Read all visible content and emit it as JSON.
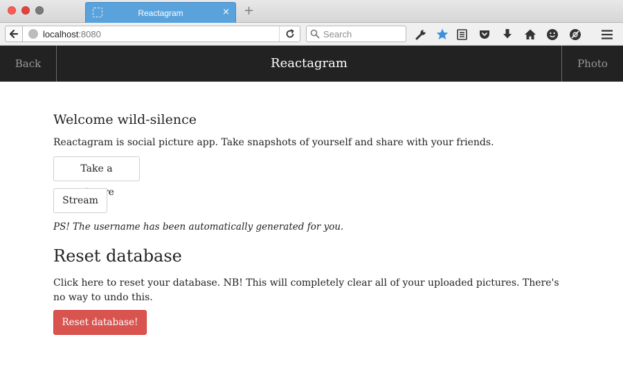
{
  "browser": {
    "tab_title": "Reactagram",
    "tab_close": "×",
    "new_tab": "+",
    "url_host": "localhost",
    "url_port": ":8080",
    "search_placeholder": "Search",
    "toolbar_icons": [
      "back-arrow-icon",
      "globe-icon",
      "reload-icon",
      "search-icon",
      "wrench-icon",
      "bookmark-star-icon",
      "reading-list-icon",
      "pocket-icon",
      "download-icon",
      "home-icon",
      "smiley-icon",
      "tracking-protection-icon",
      "hamburger-menu-icon"
    ],
    "accent_color": "#5aa2dc"
  },
  "app_header": {
    "back_label": "Back",
    "title": "Reactagram",
    "photo_label": "Photo",
    "background_color": "#222222"
  },
  "main": {
    "welcome": "Welcome wild-silence",
    "intro": "Reactagram is social picture app. Take snapshots of yourself and share with your friends.",
    "take_picture_label": "Take a picture",
    "stream_label": "Stream",
    "ps_note": "PS! The username has been automatically generated for you.",
    "reset_heading": "Reset database",
    "reset_text": "Click here to reset your database. NB! This will completely clear all of your uploaded pictures. There's no way to undo this.",
    "reset_button_label": "Reset database!",
    "danger_color": "#d9534f"
  }
}
